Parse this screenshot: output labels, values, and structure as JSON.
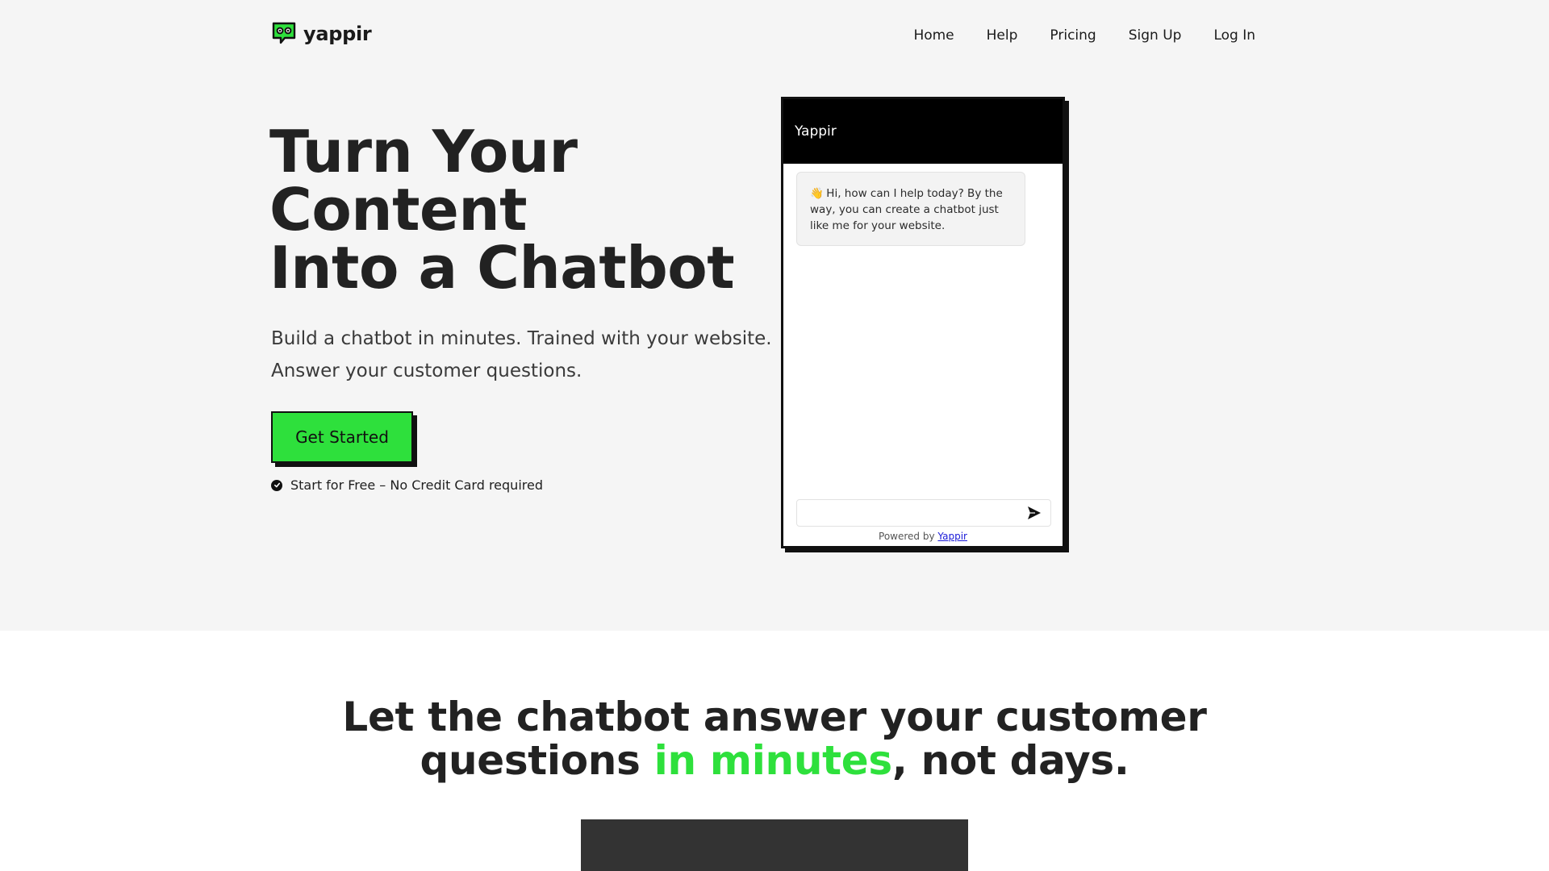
{
  "brand": {
    "name": "yappir",
    "logo_icon": "chat-bubble-eyes-icon",
    "accent_color": "#2ee03c"
  },
  "nav": {
    "items": [
      "Home",
      "Help",
      "Pricing",
      "Sign Up",
      "Log In"
    ]
  },
  "hero": {
    "title_lines": [
      "Turn Your",
      "Content",
      "Into a Chatbot"
    ],
    "subtitle_lines": [
      "Build a chatbot in minutes. Trained with your website.",
      "Answer your customer questions."
    ],
    "cta_label": "Get Started",
    "note": "Start for Free – No Credit Card required",
    "note_icon": "check-circle-icon"
  },
  "widget": {
    "title": "Yappir",
    "message": "Hi, how can I help today? By the way, you can create a chatbot just like me for your website.",
    "message_icon": "waving-hand-icon",
    "input_placeholder": "",
    "send_icon": "send-arrow-icon",
    "powered_prefix": "Powered by",
    "powered_link": "Yappir"
  },
  "section2": {
    "line1": "Let the chatbot answer your customer",
    "line2_pre": "questions ",
    "line2_accent": "in minutes",
    "line2_post": ", not days."
  }
}
